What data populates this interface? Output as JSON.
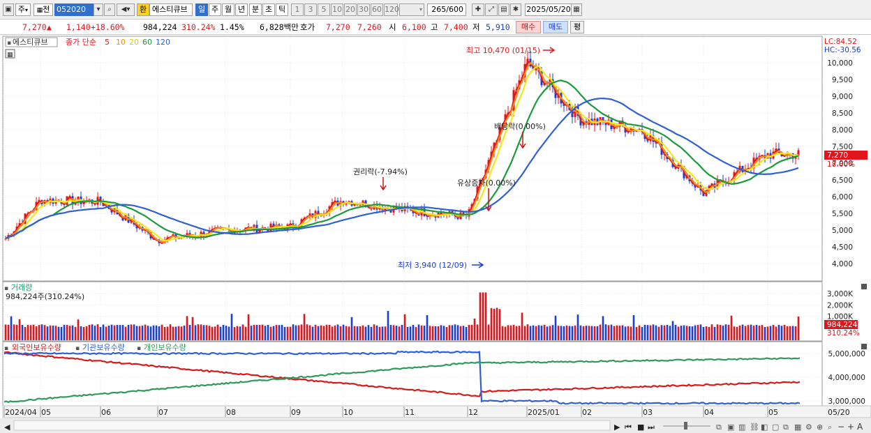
{
  "toolbar": {
    "period_label": "주",
    "prev_label": "전",
    "code": "052020",
    "exchange_label": "환",
    "stock_name": "에스티큐브",
    "period_tabs": [
      {
        "label": "일",
        "selected": true
      },
      {
        "label": "주"
      },
      {
        "label": "월"
      },
      {
        "label": "년"
      },
      {
        "label": "분"
      },
      {
        "label": "초"
      },
      {
        "label": "틱"
      }
    ],
    "intervals": [
      "1",
      "3",
      "5",
      "10",
      "20",
      "30",
      "60",
      "120"
    ],
    "count": "265",
    "count_total": "/600",
    "date": "2025/05/20"
  },
  "quote": {
    "price": "7,270",
    "arrow": "▲",
    "change": "1,140",
    "change_pct": "+18.60%",
    "volume": "984,224",
    "volume_pct": "310.24%",
    "turnover_pct": "1.45%",
    "trade_value": "6,828백만",
    "bid_label": "호가",
    "ask_price": "7,270",
    "bid_price": "7,260",
    "open_label": "시",
    "open": "6,100",
    "high_label": "고",
    "high": "7,400",
    "low_label": "저",
    "low": "5,910",
    "buy_label": "매수",
    "sell_label": "매도",
    "avg_label": "평"
  },
  "price_panel": {
    "name": "에스티큐브",
    "ma_label": "종가 단순",
    "ma_periods": [
      "5",
      "10",
      "20",
      "60",
      "120"
    ],
    "ma_colors": [
      "#e0161a",
      "#f08c1c",
      "#f5e61a",
      "#1a9a3a",
      "#2e5fd8"
    ],
    "lc": "LC:84.52",
    "hc": "HC:-30.56",
    "current_price": "7,270",
    "current_pct": "18.60%",
    "high_annotation": "최고 10,470 (01/15)",
    "low_annotation": "최저 3,940 (12/09)",
    "events": [
      "권리락(-7.94%)",
      "유상증자(0.00%)",
      "배당락(0.00%)"
    ]
  },
  "volume_panel": {
    "title": "거래량",
    "value": "984,224주(310.24%)",
    "current": "984,224",
    "current_pct": "310.24%"
  },
  "holdings_panel": {
    "legend": [
      "외국인보유수량",
      "기관보유수량",
      "개인보유수량"
    ]
  },
  "x_axis": {
    "labels": [
      "2024/04",
      "05",
      "06",
      "07",
      "08",
      "09",
      "10",
      "11",
      "12",
      "2025/01",
      "02",
      "03",
      "04",
      "05"
    ],
    "right_label": "05/20"
  },
  "colors": {
    "up": "#e0161a",
    "down": "#1a3fd4",
    "foreign": "#d8181a",
    "institution": "#2e5fd8",
    "individual": "#2e9a5a"
  },
  "chart_data": [
    {
      "type": "candlestick",
      "panel": "price",
      "ylim": [
        3700,
        10500
      ],
      "y_ticks": [
        "10,000",
        "9,500",
        "9,000",
        "8,500",
        "8,000",
        "7,500",
        "7,000",
        "6,500",
        "6,000",
        "5,500",
        "5,000",
        "4,500",
        "4,000"
      ],
      "monthly_levels": [
        {
          "month": "2024/04",
          "price": 4700
        },
        {
          "month": "05",
          "price": 5900
        },
        {
          "month": "06",
          "price": 5850
        },
        {
          "month": "07",
          "price": 4700
        },
        {
          "month": "08",
          "price": 5000
        },
        {
          "month": "09",
          "price": 5100
        },
        {
          "month": "10",
          "price": 5900
        },
        {
          "month": "11",
          "price": 5600
        },
        {
          "month": "12",
          "price": 5400
        },
        {
          "month": "2025/01",
          "price": 10000
        },
        {
          "month": "02",
          "price": 8300
        },
        {
          "month": "03",
          "price": 8000
        },
        {
          "month": "04",
          "price": 6100
        },
        {
          "month": "05",
          "price": 7270
        }
      ]
    },
    {
      "type": "bar",
      "panel": "volume",
      "y_ticks": [
        "3,000K",
        "2,000K",
        "1,000K"
      ]
    },
    {
      "type": "line",
      "panel": "holdings",
      "y_ticks": [
        "5,000,000",
        "4,000,000",
        "3,000,000"
      ],
      "series": [
        {
          "name": "외국인보유수량",
          "start": 5050000,
          "end": 3800000
        },
        {
          "name": "기관보유수량",
          "start": 5000000,
          "end": 2900000
        },
        {
          "name": "개인보유수량",
          "start": 2950000,
          "end": 4800000
        }
      ]
    }
  ]
}
